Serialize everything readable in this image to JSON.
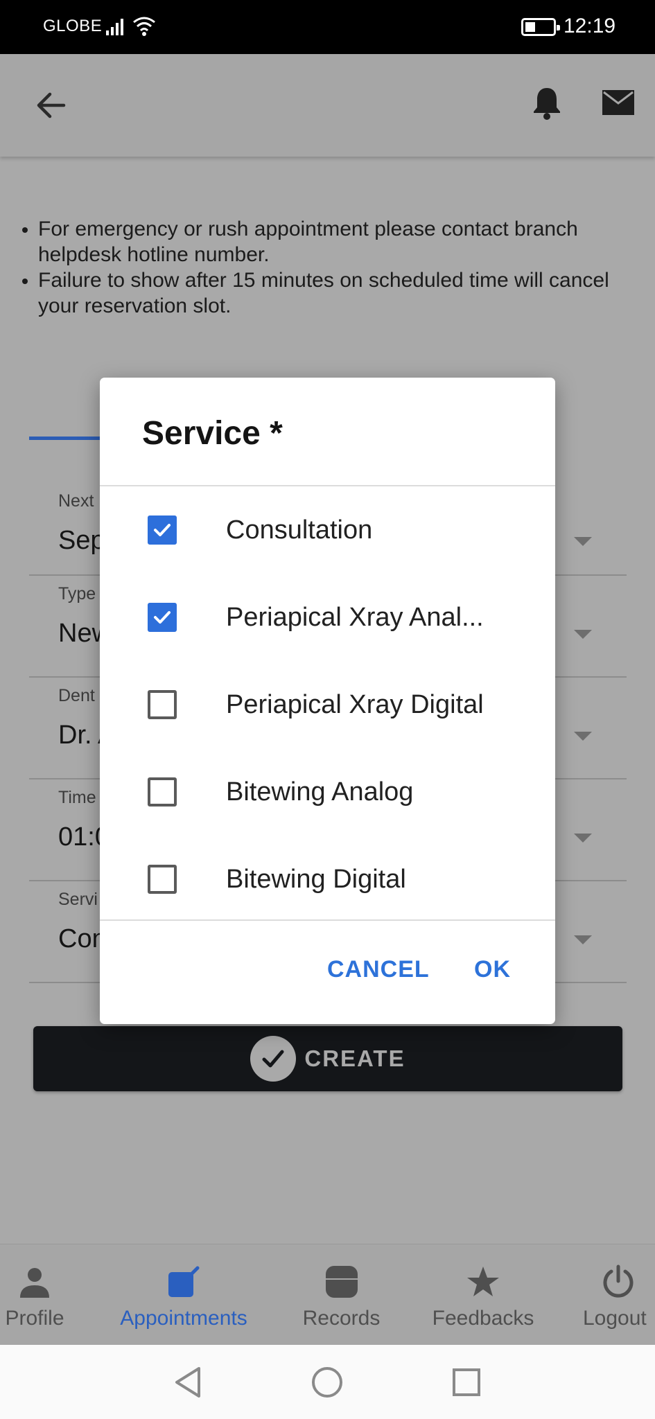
{
  "status_bar": {
    "carrier": "GLOBE",
    "time": "12:19"
  },
  "app_bar": {
    "icons": [
      "back-arrow-icon",
      "bell-icon",
      "mail-icon"
    ]
  },
  "notes": [
    "For emergency or rush appointment please contact branch helpdesk hotline number.",
    "Failure to show after 15 minutes on scheduled time will cancel your reservation slot."
  ],
  "form": {
    "fields": [
      {
        "label": "Next",
        "value": "Sep"
      },
      {
        "label": "Type",
        "value": "New"
      },
      {
        "label": "Dent",
        "value": "Dr. A"
      },
      {
        "label": "Time",
        "value": "01:0"
      },
      {
        "label": "Servi",
        "value": "Con"
      }
    ],
    "create_label": "CREATE"
  },
  "dialog": {
    "title": "Service *",
    "options": [
      {
        "label": "Consultation",
        "checked": true
      },
      {
        "label": "Periapical Xray Anal...",
        "checked": true
      },
      {
        "label": "Periapical Xray Digital",
        "checked": false
      },
      {
        "label": "Bitewing Analog",
        "checked": false
      },
      {
        "label": "Bitewing Digital",
        "checked": false
      }
    ],
    "cancel_label": "CANCEL",
    "ok_label": "OK"
  },
  "bottom_nav": {
    "items": [
      {
        "label": "Profile",
        "icon": "person-icon",
        "active": false
      },
      {
        "label": "Appointments",
        "icon": "appointment-edit-icon",
        "active": true
      },
      {
        "label": "Records",
        "icon": "records-icon",
        "active": false
      },
      {
        "label": "Feedbacks",
        "icon": "star-icon",
        "active": false
      },
      {
        "label": "Logout",
        "icon": "power-icon",
        "active": false
      }
    ]
  },
  "colors": {
    "accent": "#2d72d9",
    "active_nav": "#2a5fbf",
    "scrim": "#a9a9a9"
  }
}
